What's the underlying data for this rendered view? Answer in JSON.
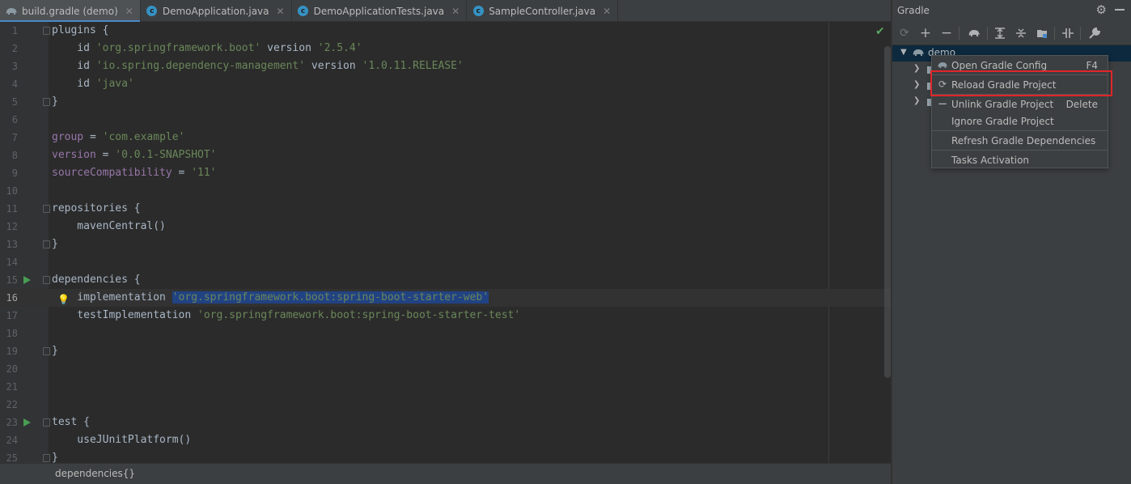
{
  "tabs": [
    {
      "label": "build.gradle (demo)",
      "icon": "gradle-elephant-icon",
      "active": true
    },
    {
      "label": "DemoApplication.java",
      "icon": "java-class-icon",
      "active": false
    },
    {
      "label": "DemoApplicationTests.java",
      "icon": "java-class-icon",
      "active": false
    },
    {
      "label": "SampleController.java",
      "icon": "java-class-icon",
      "active": false
    }
  ],
  "editor": {
    "current_line": 16,
    "lines": [
      {
        "n": "1",
        "parts": [
          [
            "kw",
            "plugins {"
          ]
        ]
      },
      {
        "n": "2",
        "parts": [
          [
            "kw",
            "    id "
          ],
          [
            "str",
            "'org.springframework.boot'"
          ],
          [
            "kw",
            " version "
          ],
          [
            "str",
            "'2.5.4'"
          ]
        ]
      },
      {
        "n": "3",
        "parts": [
          [
            "kw",
            "    id "
          ],
          [
            "str",
            "'io.spring.dependency-management'"
          ],
          [
            "kw",
            " version "
          ],
          [
            "str",
            "'1.0.11.RELEASE'"
          ]
        ]
      },
      {
        "n": "4",
        "parts": [
          [
            "kw",
            "    id "
          ],
          [
            "str",
            "'java'"
          ]
        ]
      },
      {
        "n": "5",
        "parts": [
          [
            "kw",
            "}"
          ]
        ]
      },
      {
        "n": "6",
        "parts": []
      },
      {
        "n": "7",
        "parts": [
          [
            "prop",
            "group"
          ],
          [
            "kw",
            " = "
          ],
          [
            "str",
            "'com.example'"
          ]
        ]
      },
      {
        "n": "8",
        "parts": [
          [
            "prop",
            "version"
          ],
          [
            "kw",
            " = "
          ],
          [
            "str",
            "'0.0.1-SNAPSHOT'"
          ]
        ]
      },
      {
        "n": "9",
        "parts": [
          [
            "prop",
            "sourceCompatibility"
          ],
          [
            "kw",
            " = "
          ],
          [
            "str",
            "'11'"
          ]
        ]
      },
      {
        "n": "10",
        "parts": []
      },
      {
        "n": "11",
        "parts": [
          [
            "kw",
            "repositories {"
          ]
        ]
      },
      {
        "n": "12",
        "parts": [
          [
            "kw",
            "    mavenCentral()"
          ]
        ]
      },
      {
        "n": "13",
        "parts": [
          [
            "kw",
            "}"
          ]
        ]
      },
      {
        "n": "14",
        "parts": []
      },
      {
        "n": "15",
        "parts": [
          [
            "kw",
            "dependencies {"
          ]
        ]
      },
      {
        "n": "16",
        "parts": [
          [
            "kw",
            "    implementation "
          ],
          [
            "sel",
            "'org.springframework.boot:spring-boot-starter-web'"
          ]
        ]
      },
      {
        "n": "17",
        "parts": [
          [
            "kw",
            "    testImplementation "
          ],
          [
            "str",
            "'org.springframework.boot:spring-boot-starter-test'"
          ]
        ]
      },
      {
        "n": "18",
        "parts": []
      },
      {
        "n": "19",
        "parts": [
          [
            "kw",
            "}"
          ]
        ]
      },
      {
        "n": "20",
        "parts": []
      },
      {
        "n": "21",
        "parts": []
      },
      {
        "n": "22",
        "parts": []
      },
      {
        "n": "23",
        "parts": [
          [
            "kw",
            "test {"
          ]
        ]
      },
      {
        "n": "24",
        "parts": [
          [
            "kw",
            "    useJUnitPlatform()"
          ]
        ]
      },
      {
        "n": "25",
        "parts": [
          [
            "kw",
            "}"
          ]
        ]
      }
    ]
  },
  "breadcrumb": "dependencies{}",
  "gradle_panel": {
    "title": "Gradle",
    "tree_root": "demo",
    "toolbar_icons": [
      "reload-all-icon",
      "add-icon",
      "remove-icon",
      "gradle-elephant-icon",
      "expand-all-icon",
      "collapse-all-icon",
      "group-modules-icon",
      "toggle-offline-icon",
      "build-tool-settings-icon"
    ]
  },
  "context_menu": {
    "items": [
      {
        "label": "Open Gradle Config",
        "shortcut": "F4",
        "icon": "gradle-elephant-icon"
      },
      {
        "label": "Reload Gradle Project",
        "shortcut": "",
        "icon": "reload-icon"
      },
      {
        "label": "Unlink Gradle Project",
        "shortcut": "Delete",
        "icon": "minus-icon"
      },
      {
        "label": "Ignore Gradle Project",
        "shortcut": "",
        "icon": ""
      },
      {
        "label": "Refresh Gradle Dependencies",
        "shortcut": "",
        "icon": ""
      },
      {
        "label": "Tasks Activation",
        "shortcut": "",
        "icon": ""
      }
    ]
  }
}
